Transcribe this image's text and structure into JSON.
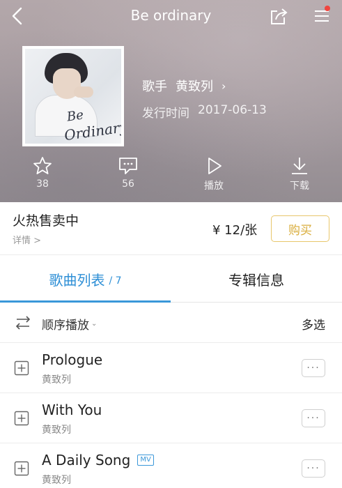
{
  "header": {
    "title": "Be ordinary",
    "icons": {
      "back": "back-arrow-icon",
      "share": "share-icon",
      "menu": "menu-icon",
      "notification_dot_color": "#f0453f"
    }
  },
  "album": {
    "cover_text_line1": "Be",
    "cover_text_line2": "Ordinary",
    "singer_label": "歌手",
    "singer_name": "黄致列",
    "singer_chevron": "›",
    "release_label": "发行时间",
    "release_date": "2017-06-13"
  },
  "actions": [
    {
      "icon": "star-icon",
      "label": "38"
    },
    {
      "icon": "comment-icon",
      "label": "56"
    },
    {
      "icon": "play-icon",
      "label": "播放"
    },
    {
      "icon": "download-icon",
      "label": "下载"
    }
  ],
  "sale": {
    "status": "火热售卖中",
    "detail": "详情 >",
    "price": "¥ 12/张",
    "buy_label": "购买",
    "buy_color": "#d9ad3c"
  },
  "tabs": {
    "songs_label": "歌曲列表",
    "songs_count": "/ 7",
    "info_label": "专辑信息",
    "accent": "#2e8fd6"
  },
  "playbar": {
    "mode_label": "顺序播放",
    "mode_arrow": "⌄",
    "multi_select": "多选"
  },
  "songs": [
    {
      "title": "Prologue",
      "artist": "黄致列",
      "mv": ""
    },
    {
      "title": "With You",
      "artist": "黄致列",
      "mv": ""
    },
    {
      "title": "A Daily Song",
      "artist": "黄致列",
      "mv": "MV"
    }
  ],
  "more_label": "···"
}
